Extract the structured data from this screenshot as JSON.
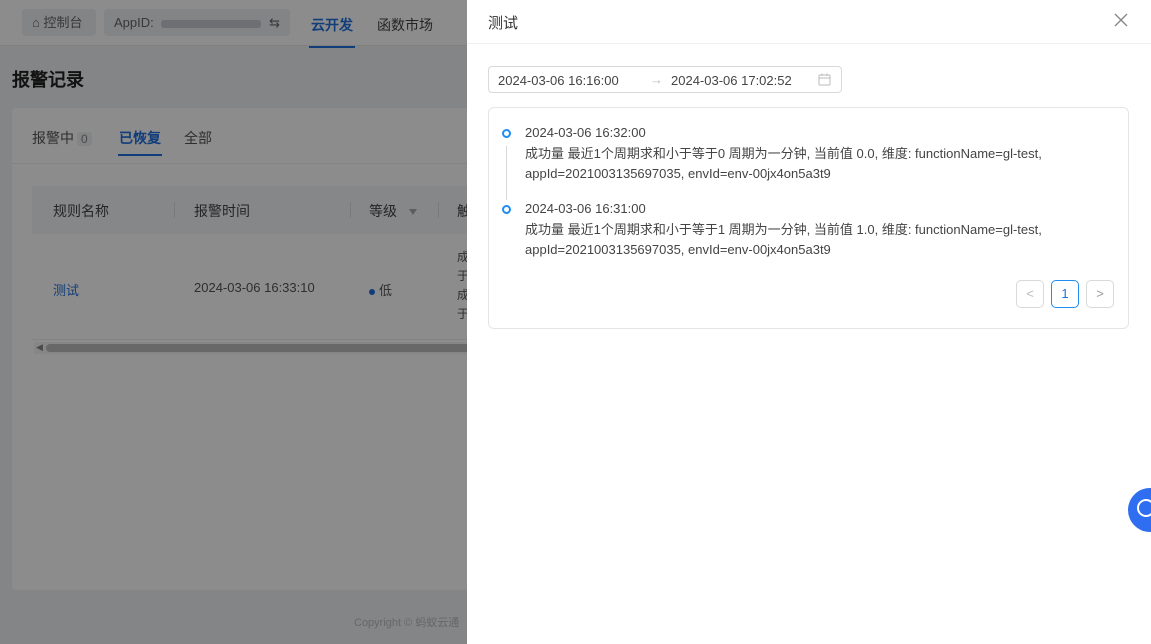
{
  "topbar": {
    "console_label": "控制台",
    "appid_label": "AppID:",
    "swap_icon": "⇆",
    "nav": [
      {
        "label": "云开发",
        "active": true
      },
      {
        "label": "函数市场",
        "active": false
      }
    ]
  },
  "page": {
    "title": "报警记录",
    "tabs": [
      {
        "label": "报警中",
        "count": "0"
      },
      {
        "label": "已恢复",
        "count": ""
      },
      {
        "label": "全部",
        "count": ""
      }
    ],
    "table": {
      "headers": [
        "规则名称",
        "报警时间",
        "等级",
        "触"
      ],
      "row": {
        "name": "测试",
        "time": "2024-03-06 16:33:10",
        "level": "低",
        "trigger_lines": [
          "成",
          "于",
          "成",
          "于"
        ]
      }
    },
    "copyright": "Copyright © 蚂蚁云通（"
  },
  "drawer": {
    "title": "测试",
    "range": {
      "start": "2024-03-06 16:16:00",
      "separator": "→",
      "end": "2024-03-06 17:02:52"
    },
    "logs": [
      {
        "time": "2024-03-06 16:32:00",
        "message": "成功量 最近1个周期求和小于等于0 周期为一分钟, 当前值 0.0, 维度: functionName=gl-test, appId=2021003135697035, envId=env-00jx4on5a3t9"
      },
      {
        "time": "2024-03-06 16:31:00",
        "message": "成功量 最近1个周期求和小于等于1 周期为一分钟, 当前值 1.0, 维度: functionName=gl-test, appId=2021003135697035, envId=env-00jx4on5a3t9"
      }
    ],
    "pagination": {
      "prev": "<",
      "current": "1",
      "next": ">"
    }
  },
  "colors": {
    "accent": "#1f6fe0",
    "overlay": "rgba(0,0,0,0.45)"
  }
}
